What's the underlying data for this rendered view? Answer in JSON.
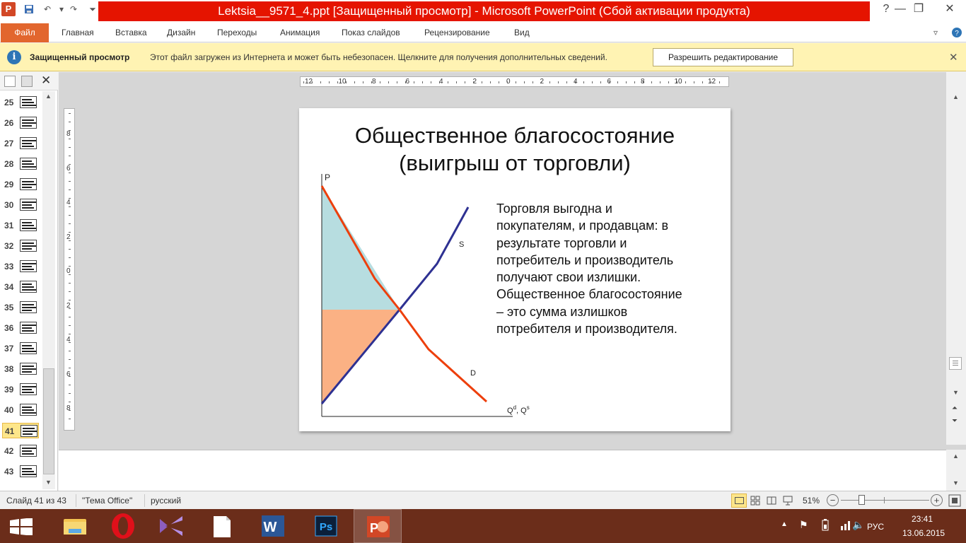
{
  "window": {
    "title": "Lektsia__9571_4.ppt [Защищенный просмотр] - Microsoft PowerPoint (Сбой активации продукта)",
    "app_icon_letter": "P",
    "help": "?"
  },
  "ribbon": {
    "file": "Файл",
    "tabs": [
      "Главная",
      "Вставка",
      "Дизайн",
      "Переходы",
      "Анимация",
      "Показ слайдов",
      "Рецензирование",
      "Вид"
    ]
  },
  "protected_view": {
    "title": "Защищенный просмотр",
    "message": "Этот файл загружен из Интернета и может быть небезопасен. Щелкните для получения дополнительных сведений.",
    "button": "Разрешить редактирование",
    "icon": "i"
  },
  "slides_panel": {
    "numbers": [
      "25",
      "26",
      "27",
      "28",
      "29",
      "30",
      "31",
      "32",
      "33",
      "34",
      "35",
      "36",
      "37",
      "38",
      "39",
      "40",
      "41",
      "42",
      "43"
    ],
    "active": "41"
  },
  "ruler": {
    "h_labels": [
      "12",
      "10",
      "8",
      "6",
      "4",
      "2",
      "0",
      "2",
      "4",
      "6",
      "8",
      "10",
      "12"
    ],
    "v_labels": [
      "8",
      "6",
      "4",
      "2",
      "0",
      "2",
      "4",
      "6",
      "8"
    ]
  },
  "slide": {
    "title_line1": "Общественное  благосостояние",
    "title_line2": "(выигрыш  от торговли)",
    "body_lines": [
      "Торговля  выгодна и",
      "покупателям,  и продавцам:  в",
      "результате торговли и",
      "потребитель  и производитель",
      "получают  свои излишки.",
      "Общественное  благосостояние",
      "– это сумма  излишков",
      "потребителя  и производителя."
    ],
    "chart": {
      "y_axis_label": "P",
      "x_axis_label": "Q",
      "x_axis_sup1": "d",
      "x_axis_mid": ", Q",
      "x_axis_sup2": "s",
      "supply_label": "S",
      "demand_label": "D",
      "colors": {
        "supply": "#2e3192",
        "demand": "#ed3f0c",
        "consumer_surplus": "#b7dde0",
        "producer_surplus": "#fbb184"
      }
    }
  },
  "status": {
    "slide_info": "Слайд 41 из 43",
    "theme": "\"Тема Office\"",
    "language": "русский",
    "zoom": "51%",
    "zoom_minus": "−",
    "zoom_plus": "+"
  },
  "taskbar": {
    "language": "РУС",
    "time": "23:41",
    "date": "13.06.2015",
    "apps": [
      "file-explorer",
      "opera",
      "visual-studio",
      "document",
      "word",
      "photoshop",
      "powerpoint"
    ],
    "word_letter": "W",
    "ps_letter": "Ps",
    "pp_letter": "P"
  }
}
